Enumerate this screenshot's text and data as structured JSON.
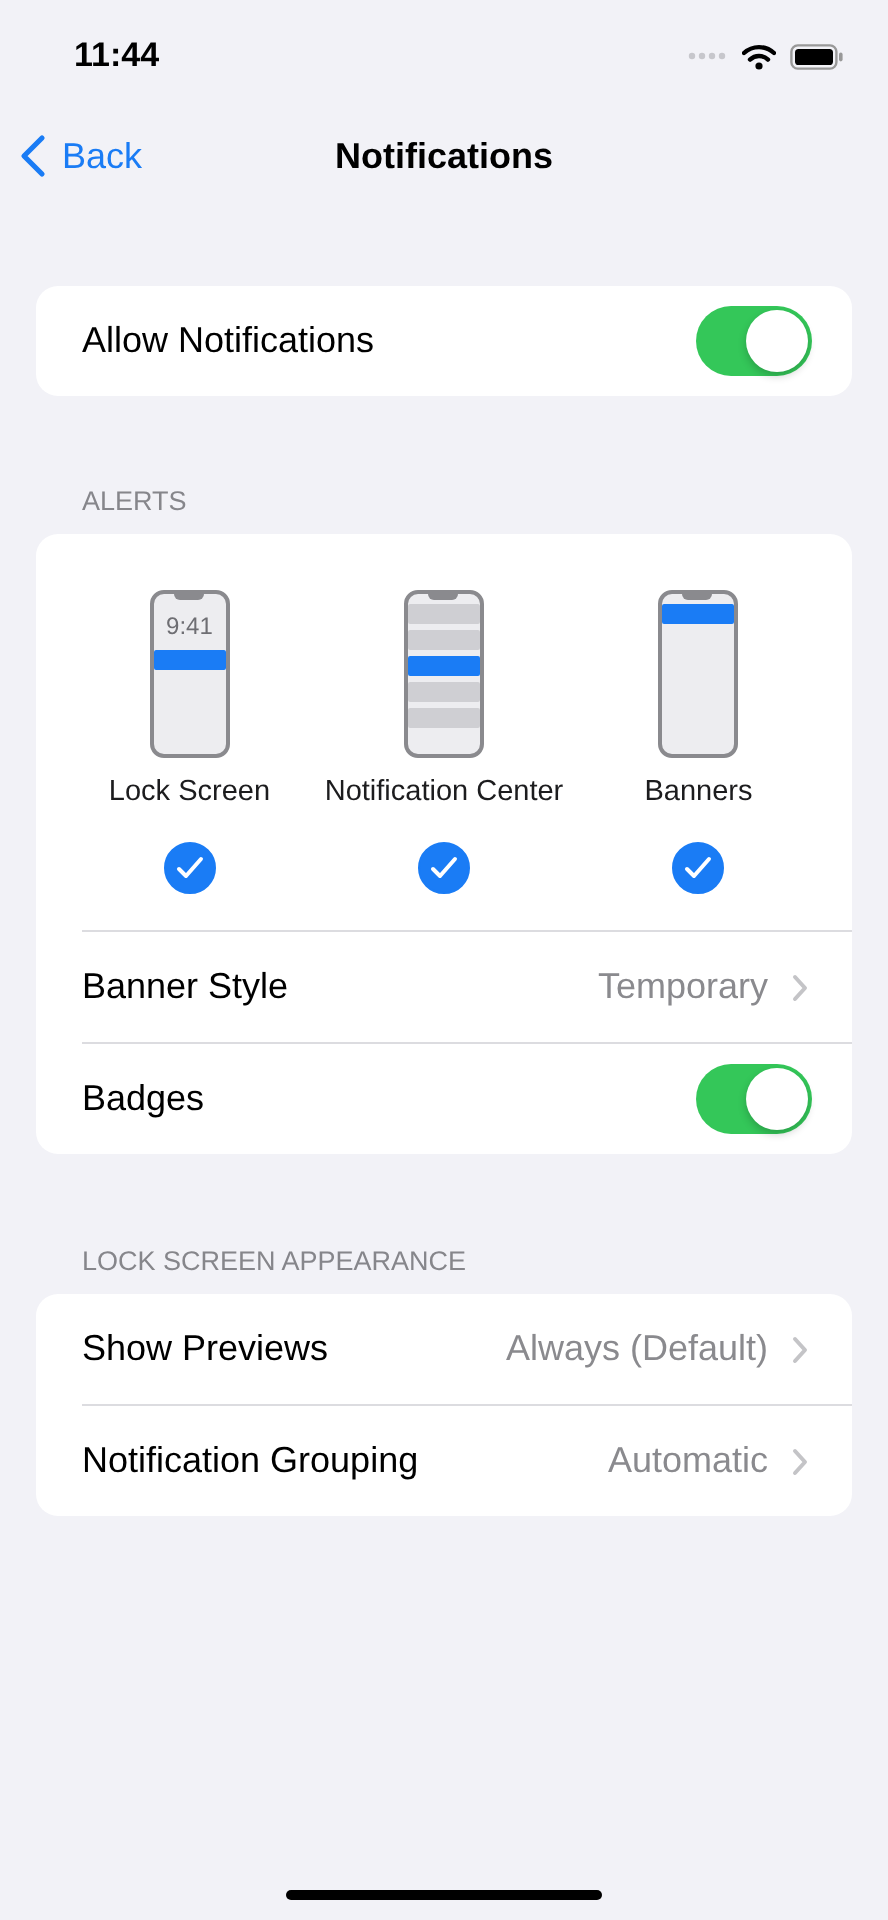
{
  "status_bar": {
    "time": "11:44"
  },
  "nav": {
    "back": "Back",
    "title": "Notifications"
  },
  "allow": {
    "label": "Allow Notifications",
    "on": true
  },
  "alerts": {
    "header": "ALERTS",
    "options": [
      {
        "kind": "lock",
        "label": "Lock Screen",
        "clock": "9:41",
        "checked": true
      },
      {
        "kind": "center",
        "label": "Notification Center",
        "checked": true
      },
      {
        "kind": "banners",
        "label": "Banners",
        "checked": true
      }
    ],
    "rows": [
      {
        "kind": "value",
        "label": "Banner Style",
        "value": "Temporary"
      },
      {
        "kind": "toggle",
        "label": "Badges",
        "on": true
      }
    ]
  },
  "lock_screen": {
    "header": "LOCK SCREEN APPEARANCE",
    "rows": [
      {
        "kind": "value",
        "label": "Show Previews",
        "value": "Always (Default)"
      },
      {
        "kind": "value",
        "label": "Notification Grouping",
        "value": "Automatic"
      }
    ]
  }
}
